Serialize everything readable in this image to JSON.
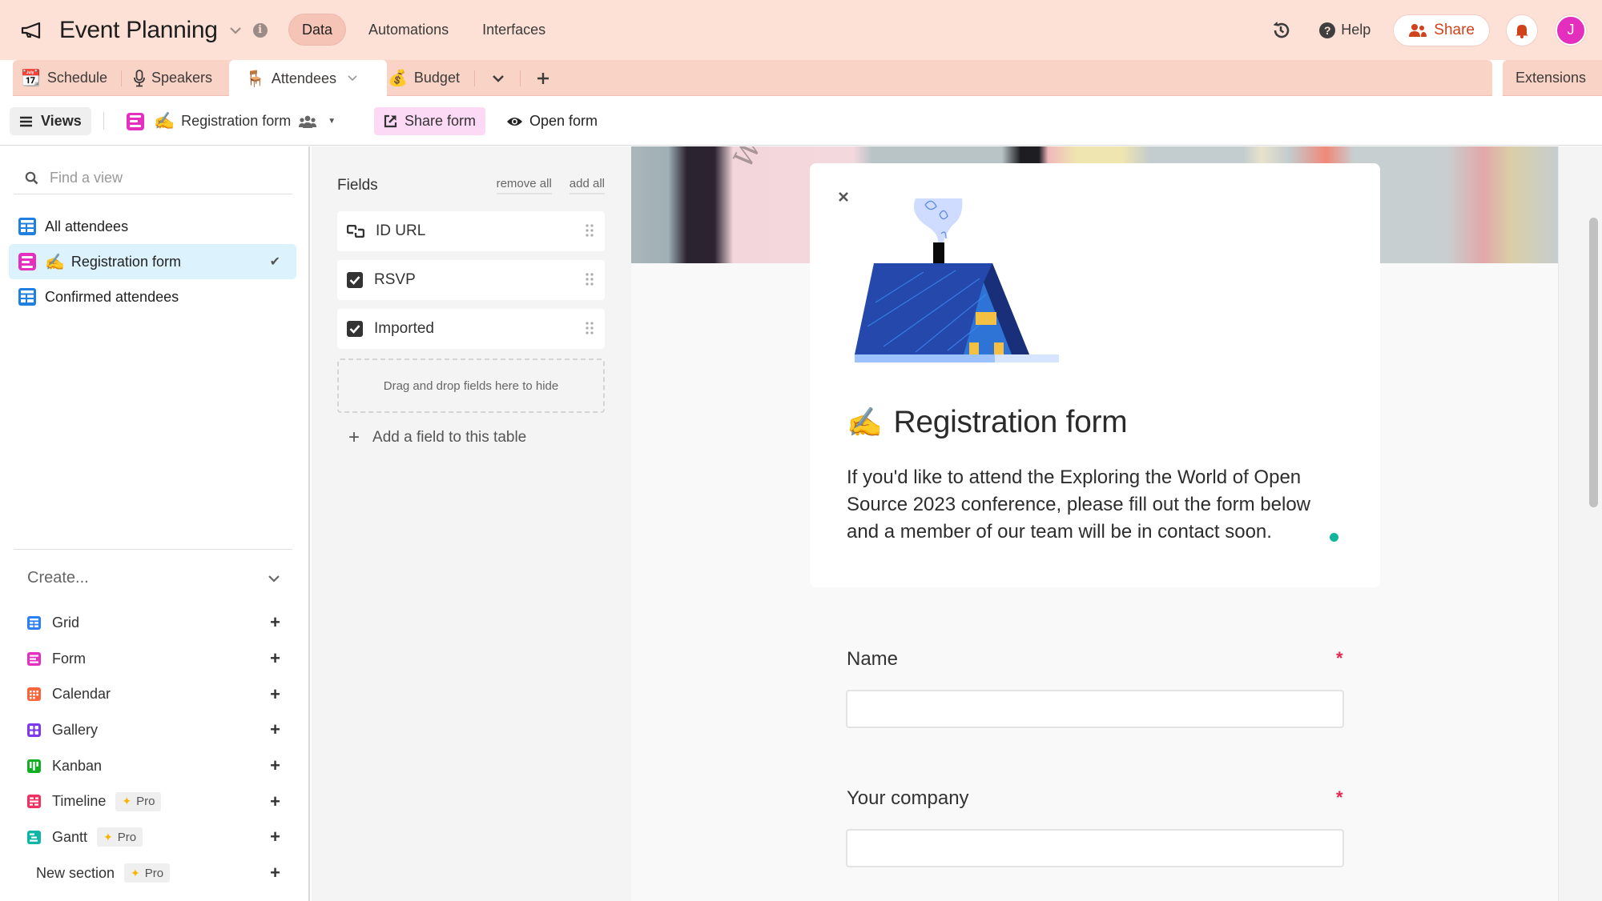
{
  "topbar": {
    "base_icon": "megaphone-icon",
    "base_title": "Event Planning",
    "nav": [
      {
        "label": "Data",
        "active": true
      },
      {
        "label": "Automations",
        "active": false
      },
      {
        "label": "Interfaces",
        "active": false
      }
    ],
    "help_label": "Help",
    "share_label": "Share",
    "avatar_initial": "J",
    "colors": {
      "background": "#fde0d6",
      "share_text": "#d0421b",
      "avatar": "#e42ebd"
    }
  },
  "tabs": {
    "items": [
      {
        "emoji": "📆",
        "label": "Schedule"
      },
      {
        "emoji": "🎙",
        "label": "Speakers"
      },
      {
        "emoji": "🪑",
        "label": "Attendees",
        "active": true
      },
      {
        "emoji": "💰",
        "label": "Budget"
      }
    ],
    "extensions_label": "Extensions"
  },
  "toolbar": {
    "views_label": "Views",
    "current_view": {
      "emoji": "✍️",
      "label": "Registration form"
    },
    "share_form_label": "Share form",
    "open_form_label": "Open form"
  },
  "sidebar": {
    "search_placeholder": "Find a view",
    "views": [
      {
        "type": "grid",
        "label": "All attendees",
        "selected": false
      },
      {
        "type": "form",
        "emoji": "✍️",
        "label": "Registration form",
        "selected": true
      },
      {
        "type": "grid",
        "label": "Confirmed attendees",
        "selected": false
      }
    ],
    "create_label": "Create...",
    "create_items": [
      {
        "type": "grid",
        "label": "Grid",
        "color": "#2d7ff9"
      },
      {
        "type": "form",
        "label": "Form",
        "color": "#e52fbf"
      },
      {
        "type": "calendar",
        "label": "Calendar",
        "color": "#f7653b"
      },
      {
        "type": "gallery",
        "label": "Gallery",
        "color": "#7c39ed"
      },
      {
        "type": "kanban",
        "label": "Kanban",
        "color": "#11af22"
      },
      {
        "type": "timeline",
        "label": "Timeline",
        "color": "#ef3061",
        "badge": "Pro"
      },
      {
        "type": "gantt",
        "label": "Gantt",
        "color": "#0fb5a6",
        "badge": "Pro"
      },
      {
        "type": "section",
        "label": "New section",
        "badge": "Pro"
      }
    ]
  },
  "fields_panel": {
    "title": "Fields",
    "remove_all": "remove all",
    "add_all": "add all",
    "fields": [
      {
        "icon": "link-icon",
        "label": "ID URL"
      },
      {
        "icon": "checkbox-icon",
        "label": "RSVP"
      },
      {
        "icon": "checkbox-icon",
        "label": "Imported"
      }
    ],
    "dropzone_text": "Drag and drop fields here to hide",
    "add_field_label": "Add a field to this table"
  },
  "form": {
    "cover_text": "Wow",
    "title_emoji": "✍️",
    "title": "Registration form",
    "description": "If you'd like to attend the Exploring the World of Open Source 2023 conference, please fill out the form below and a member of our team will be in contact soon.",
    "questions": [
      {
        "label": "Name",
        "required": true,
        "required_mark": "*",
        "value": ""
      },
      {
        "label": "Your company",
        "required": true,
        "required_mark": "*",
        "value": ""
      }
    ]
  }
}
